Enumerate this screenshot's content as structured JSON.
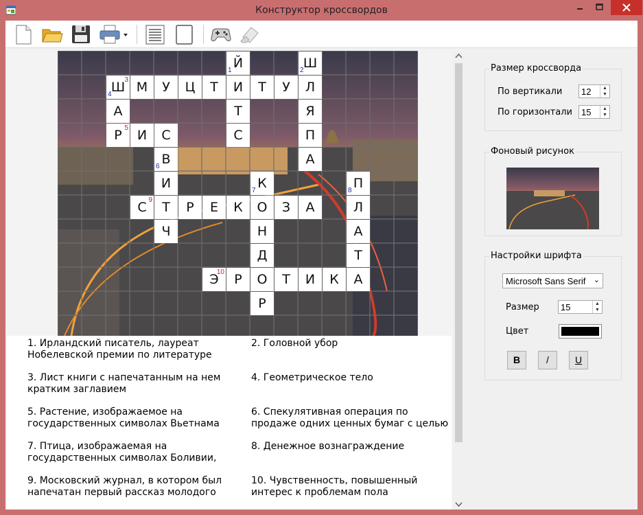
{
  "window": {
    "title": "Конструктор кроссвордов"
  },
  "colors": {
    "titlebar": "#c96e6f",
    "close": "#c7302a",
    "cell_number_blue": "#1a2a9e",
    "cell_number_red": "#c0201b",
    "font_color": "#000000"
  },
  "toolbar": {
    "buttons": [
      {
        "name": "new-icon"
      },
      {
        "name": "open-folder-icon"
      },
      {
        "name": "save-icon"
      },
      {
        "name": "print-icon"
      },
      {
        "name": "questions-list-icon"
      },
      {
        "name": "blank-page-icon"
      },
      {
        "name": "game-controller-icon"
      },
      {
        "name": "eraser-icon"
      }
    ]
  },
  "crossword": {
    "rows": 12,
    "cols": 15,
    "cells": [
      {
        "r": 0,
        "c": 7,
        "l": "Й",
        "n": "1",
        "nc": "blue"
      },
      {
        "r": 0,
        "c": 10,
        "l": "Ш",
        "n": "2",
        "nc": "blue"
      },
      {
        "r": 1,
        "c": 2,
        "l": "Ш",
        "n": "3",
        "nc": "red",
        "n2": "4",
        "n2c": "blue"
      },
      {
        "r": 1,
        "c": 3,
        "l": "М"
      },
      {
        "r": 1,
        "c": 4,
        "l": "У"
      },
      {
        "r": 1,
        "c": 5,
        "l": "Ц"
      },
      {
        "r": 1,
        "c": 6,
        "l": "Т"
      },
      {
        "r": 1,
        "c": 7,
        "l": "И"
      },
      {
        "r": 1,
        "c": 8,
        "l": "Т"
      },
      {
        "r": 1,
        "c": 9,
        "l": "У"
      },
      {
        "r": 1,
        "c": 10,
        "l": "Л"
      },
      {
        "r": 2,
        "c": 2,
        "l": "А"
      },
      {
        "r": 2,
        "c": 7,
        "l": "Т"
      },
      {
        "r": 2,
        "c": 10,
        "l": "Я"
      },
      {
        "r": 3,
        "c": 2,
        "l": "Р",
        "n": "5",
        "nc": "red"
      },
      {
        "r": 3,
        "c": 3,
        "l": "И"
      },
      {
        "r": 3,
        "c": 4,
        "l": "С"
      },
      {
        "r": 3,
        "c": 7,
        "l": "С"
      },
      {
        "r": 3,
        "c": 10,
        "l": "П"
      },
      {
        "r": 4,
        "c": 4,
        "l": "В",
        "n": "6",
        "nc": "blue"
      },
      {
        "r": 4,
        "c": 10,
        "l": "А"
      },
      {
        "r": 5,
        "c": 4,
        "l": "И"
      },
      {
        "r": 5,
        "c": 8,
        "l": "К",
        "n": "7",
        "nc": "blue"
      },
      {
        "r": 5,
        "c": 12,
        "l": "П",
        "n": "8",
        "nc": "blue"
      },
      {
        "r": 6,
        "c": 3,
        "l": "С",
        "n": "9",
        "nc": "red"
      },
      {
        "r": 6,
        "c": 4,
        "l": "Т"
      },
      {
        "r": 6,
        "c": 5,
        "l": "Р"
      },
      {
        "r": 6,
        "c": 6,
        "l": "Е"
      },
      {
        "r": 6,
        "c": 7,
        "l": "К"
      },
      {
        "r": 6,
        "c": 8,
        "l": "О"
      },
      {
        "r": 6,
        "c": 9,
        "l": "З"
      },
      {
        "r": 6,
        "c": 10,
        "l": "А"
      },
      {
        "r": 6,
        "c": 12,
        "l": "Л"
      },
      {
        "r": 7,
        "c": 4,
        "l": "Ч"
      },
      {
        "r": 7,
        "c": 8,
        "l": "Н"
      },
      {
        "r": 7,
        "c": 12,
        "l": "А"
      },
      {
        "r": 8,
        "c": 8,
        "l": "Д"
      },
      {
        "r": 8,
        "c": 12,
        "l": "Т"
      },
      {
        "r": 9,
        "c": 6,
        "l": "Э",
        "n": "10",
        "nc": "red"
      },
      {
        "r": 9,
        "c": 7,
        "l": "Р"
      },
      {
        "r": 9,
        "c": 8,
        "l": "О"
      },
      {
        "r": 9,
        "c": 9,
        "l": "Т"
      },
      {
        "r": 9,
        "c": 10,
        "l": "И"
      },
      {
        "r": 9,
        "c": 11,
        "l": "К"
      },
      {
        "r": 9,
        "c": 12,
        "l": "А"
      },
      {
        "r": 10,
        "c": 8,
        "l": "Р"
      }
    ]
  },
  "questions": [
    "1.  Ирландский писатель, лауреат Нобелевской премии по литературе",
    "2.  Головной убор",
    "3.  Лист книги с напечатанным на нем кратким заглавием",
    "4.  Геометрическое тело",
    "5.  Растение, изображаемое на государственных символах Вьетнама и",
    "6.  Спекулятивная операция по продаже одних ценных бумаг с целью",
    "7.  Птица, изображаемая на государственных символах Боливии,",
    "8.  Денежное вознаграждение",
    "9.  Московский журнал, в котором был напечатан первый рассказ молодого",
    "10.  Чувственность, повышенный интерес к проблемам пола"
  ],
  "size_group": {
    "title": "Размер кроссворда",
    "vertical_label": "По вертикали",
    "vertical_value": "12",
    "horizontal_label": "По горизонтали",
    "horizontal_value": "15"
  },
  "background_group": {
    "title": "Фоновый рисунок"
  },
  "font_group": {
    "title": "Настройки шрифта",
    "font_name": "Microsoft Sans Serif",
    "size_label": "Размер",
    "size_value": "15",
    "color_label": "Цвет",
    "bold_label": "B",
    "italic_label": "/",
    "underline_label": "U"
  }
}
